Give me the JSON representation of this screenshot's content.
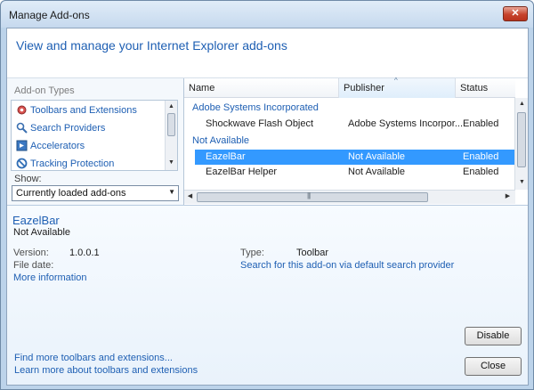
{
  "window": {
    "title": "Manage Add-ons",
    "close_glyph": "✕"
  },
  "header": {
    "text": "View and manage your Internet Explorer add-ons"
  },
  "left": {
    "types_label": "Add-on Types",
    "types": [
      {
        "label": "Toolbars and Extensions",
        "icon": "gear-icon"
      },
      {
        "label": "Search Providers",
        "icon": "search-icon"
      },
      {
        "label": "Accelerators",
        "icon": "accelerator-icon"
      },
      {
        "label": "Tracking Protection",
        "icon": "no-entry-icon"
      }
    ],
    "show_label": "Show:",
    "show_value": "Currently loaded add-ons"
  },
  "table": {
    "columns": [
      "Name",
      "Publisher",
      "Status"
    ],
    "groups": [
      {
        "label": "Adobe Systems Incorporated",
        "rows": [
          {
            "name": "Shockwave Flash Object",
            "publisher": "Adobe Systems Incorpor...",
            "status": "Enabled"
          }
        ]
      },
      {
        "label": "Not Available",
        "rows": [
          {
            "name": "EazelBar",
            "publisher": "Not Available",
            "status": "Enabled",
            "selected": true
          },
          {
            "name": "EazelBar Helper",
            "publisher": "Not Available",
            "status": "Enabled"
          }
        ]
      }
    ]
  },
  "details": {
    "name": "EazelBar",
    "publisher": "Not Available",
    "version_label": "Version:",
    "version_value": "1.0.0.1",
    "file_date_label": "File date:",
    "more_info": "More information",
    "type_label": "Type:",
    "type_value": "Toolbar",
    "search_link": "Search for this add-on via default search provider"
  },
  "footer": {
    "link1": "Find more toolbars and extensions...",
    "link2": "Learn more about toolbars and extensions",
    "disable": "Disable",
    "close": "Close"
  },
  "colors": {
    "accent": "#1e5fb3",
    "selection": "#3399ff"
  }
}
